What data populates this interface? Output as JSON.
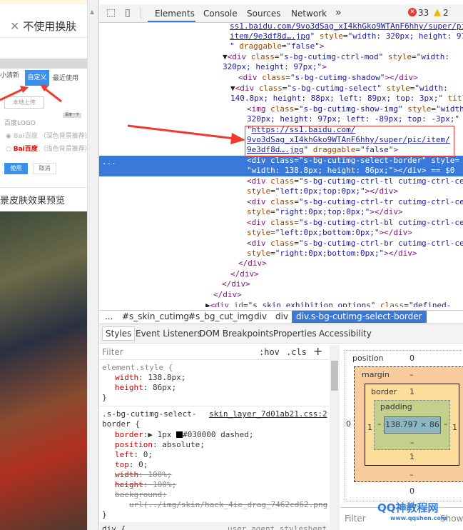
{
  "left_panel": {
    "close_label": "不使用换肤",
    "tabs": [
      "小清新",
      "自定义",
      "最近使用"
    ],
    "upload_label": "本地上传",
    "search_btn": "百度一下",
    "logo_title": "百度LOGO",
    "logo_options": [
      {
        "logo": "Bai百度",
        "note": "（深色背景推荐）",
        "checked": true
      },
      {
        "logo": "Bai百度",
        "note": "（浅色背景推荐）",
        "checked": false
      }
    ],
    "use_btn": "使用",
    "cancel_btn": "取消",
    "preview_title": "景皮肤效果预览"
  },
  "devtools": {
    "tabs": [
      "Elements",
      "Console",
      "Sources",
      "Network"
    ],
    "more": "»",
    "errors": "33",
    "warnings": "2",
    "dom_lines": [
      [
        [
          "lk",
          "ss1.baidu.com/9vo3dSag_xI4khGko9WTAnF6hhy/super/pi"
        ]
      ],
      [
        [
          "lk",
          "item/9e3df8d….jpg"
        ],
        [
          "av",
          "\""
        ],
        [
          "an",
          " style"
        ],
        [
          "tx",
          "="
        ],
        [
          "av",
          "\"width: 320px; height: 97"
        ]
      ],
      [
        [
          "av",
          "\""
        ],
        [
          "an",
          " draggable"
        ],
        [
          "tx",
          "="
        ],
        [
          "av",
          "\"false\""
        ],
        [
          "tag",
          ">"
        ]
      ],
      [
        [
          "tx",
          "▼"
        ],
        [
          "tag",
          "<div"
        ],
        [
          "an",
          " class"
        ],
        [
          "tx",
          "="
        ],
        [
          "av",
          "\"s-bg-cutimg-ctrl-mod\""
        ],
        [
          "an",
          " style"
        ],
        [
          "tx",
          "="
        ],
        [
          "av",
          "\"width:"
        ]
      ],
      [
        [
          "av",
          "320px; height: 97px;\""
        ],
        [
          "tag",
          ">"
        ]
      ],
      [
        [
          "tag",
          "<div"
        ],
        [
          "an",
          " class"
        ],
        [
          "tx",
          "="
        ],
        [
          "av",
          "\"s-bg-cutimg-shadow\""
        ],
        [
          "tag",
          "></div>"
        ]
      ],
      [
        [
          "tx",
          "▼"
        ],
        [
          "tag",
          "<div"
        ],
        [
          "an",
          " class"
        ],
        [
          "tx",
          "="
        ],
        [
          "av",
          "\"s-bg-cutimg-select\""
        ],
        [
          "an",
          " style"
        ],
        [
          "tx",
          "="
        ],
        [
          "av",
          "\"width:"
        ]
      ],
      [
        [
          "av",
          "140.8px; height: 88px; left: 89px; top: 3px;\""
        ],
        [
          "an",
          " titl"
        ]
      ],
      [
        [
          "tag",
          "<img"
        ],
        [
          "an",
          " class"
        ],
        [
          "tx",
          "="
        ],
        [
          "av",
          "\"s-bg-cutimg-show-img\""
        ],
        [
          "an",
          " style"
        ],
        [
          "tx",
          "="
        ],
        [
          "av",
          "\"width"
        ]
      ],
      [
        [
          "av",
          "320px; height: 97px; left: -89px; top: -3px;\""
        ]
      ],
      [
        [
          "av",
          "\""
        ],
        [
          "lk",
          "https://ss1.baidu.com/"
        ]
      ],
      [
        [
          "lk",
          "9vo3dSag_xI4khGko9WTAnF6hhy/super/pic/item/"
        ]
      ],
      [
        [
          "lk",
          "9e3df8d….jpg"
        ],
        [
          "av",
          "\""
        ],
        [
          "an",
          " draggable"
        ],
        [
          "tx",
          "="
        ],
        [
          "av",
          "\"false\""
        ],
        [
          "tag",
          ">"
        ]
      ],
      [
        [
          "tag",
          "<div"
        ],
        [
          "an",
          " class"
        ],
        [
          "tx",
          "="
        ],
        [
          "av",
          "\"s-bg-cutimg-select-border\""
        ],
        [
          "an",
          " style"
        ],
        [
          "tx",
          "="
        ]
      ],
      [
        [
          "av",
          "\"width: 138.8px; height: 86px;\""
        ],
        [
          "tag",
          "></div>"
        ],
        [
          "tx",
          " == $0"
        ]
      ],
      [
        [
          "tag",
          "<div"
        ],
        [
          "an",
          " class"
        ],
        [
          "tx",
          "="
        ],
        [
          "av",
          "\"s-bg-cutimg-ctrl-tl cutimg-ctrl-ce"
        ]
      ],
      [
        [
          "an",
          "style"
        ],
        [
          "tx",
          "="
        ],
        [
          "av",
          "\"left:0px;top:0px;\""
        ],
        [
          "tag",
          "></div>"
        ]
      ],
      [
        [
          "tag",
          "<div"
        ],
        [
          "an",
          " class"
        ],
        [
          "tx",
          "="
        ],
        [
          "av",
          "\"s-bg-cutimg-ctrl-tr cutimg-ctrl-ce"
        ]
      ],
      [
        [
          "an",
          "style"
        ],
        [
          "tx",
          "="
        ],
        [
          "av",
          "\"right:0px;top:0px;\""
        ],
        [
          "tag",
          "></div>"
        ]
      ],
      [
        [
          "tag",
          "<div"
        ],
        [
          "an",
          " class"
        ],
        [
          "tx",
          "="
        ],
        [
          "av",
          "\"s-bg-cutimg-ctrl-bl cutimg-ctrl-ce"
        ]
      ],
      [
        [
          "an",
          "style"
        ],
        [
          "tx",
          "="
        ],
        [
          "av",
          "\"left:0px;bottom:0px;\""
        ],
        [
          "tag",
          "></div>"
        ]
      ],
      [
        [
          "tag",
          "<div"
        ],
        [
          "an",
          " class"
        ],
        [
          "tx",
          "="
        ],
        [
          "av",
          "\"s-bg-cutimg-ctrl-br cutimg-ctrl-ce"
        ]
      ],
      [
        [
          "an",
          "style"
        ],
        [
          "tx",
          "="
        ],
        [
          "av",
          "\"right:0px;bottom:0px;\""
        ],
        [
          "tag",
          "></div>"
        ]
      ],
      [
        [
          "tag",
          "</div>"
        ]
      ],
      [
        [
          "tag",
          "</div>"
        ]
      ],
      [
        [
          "tag",
          "</div>"
        ]
      ],
      [
        [
          "tag",
          "</div>"
        ]
      ],
      [
        [
          "tx",
          "▶"
        ],
        [
          "tag",
          "<div"
        ],
        [
          "an",
          " id"
        ],
        [
          "tx",
          "="
        ],
        [
          "av",
          "\"s_skin_exhibition_options\""
        ],
        [
          "an",
          " class"
        ],
        [
          "tx",
          "="
        ],
        [
          "av",
          "\"defined-"
        ]
      ]
    ],
    "selected_line_marker": "...",
    "breadcrumb": [
      "...",
      "#s_skin_cutimg",
      "#s_bg_cut_img",
      "div",
      "div",
      "div.s-bg-cutimg-select-border"
    ],
    "style_tabs": [
      "Styles",
      "Event Listeners",
      "DOM Breakpoints",
      "Properties",
      "Accessibility"
    ],
    "filter_placeholder": "Filter",
    "hov": ":hov",
    "cls": ".cls",
    "plus": "+",
    "rules": {
      "element_style": {
        "selector": "element.style {",
        "props": [
          [
            "width",
            "138.8px;"
          ],
          [
            "height",
            "86px;"
          ]
        ]
      },
      "rule2": {
        "selector1": ".s-bg-cutimg-select-",
        "selector2": "border {",
        "source": "skin_layer_7d01ab21.css:2",
        "border_name": "border",
        "border_val1": "▶ 1px ",
        "border_color": "#030000",
        "border_val2": " dashed;",
        "props": [
          [
            "position",
            "absolute;"
          ],
          [
            "left",
            "0;"
          ],
          [
            "top",
            "0;"
          ]
        ],
        "struck": [
          [
            "width",
            "100%;"
          ],
          [
            "height",
            "100%;"
          ],
          [
            "background",
            ""
          ]
        ],
        "url": "url(../img/skin/hack_4ie_drag_7462cd62.png"
      },
      "close": "}",
      "next": "div {",
      "next_source": "user agent stylesheet"
    },
    "box_model": {
      "position_label": "position",
      "position": "0",
      "margin_label": "margin",
      "border_label": "border",
      "padding_label": "padding",
      "dash": "–",
      "border_top": "1",
      "border_bottom": "1",
      "border_left": "1",
      "border_right": "1",
      "pos_left": "0",
      "pos_bottom": "0",
      "content": "138.797 × 86"
    },
    "computed_filter": "Filter",
    "show_all": "Show all",
    "watermark": "QQ神教程网",
    "watermark_url": "www.qqshen.com"
  }
}
